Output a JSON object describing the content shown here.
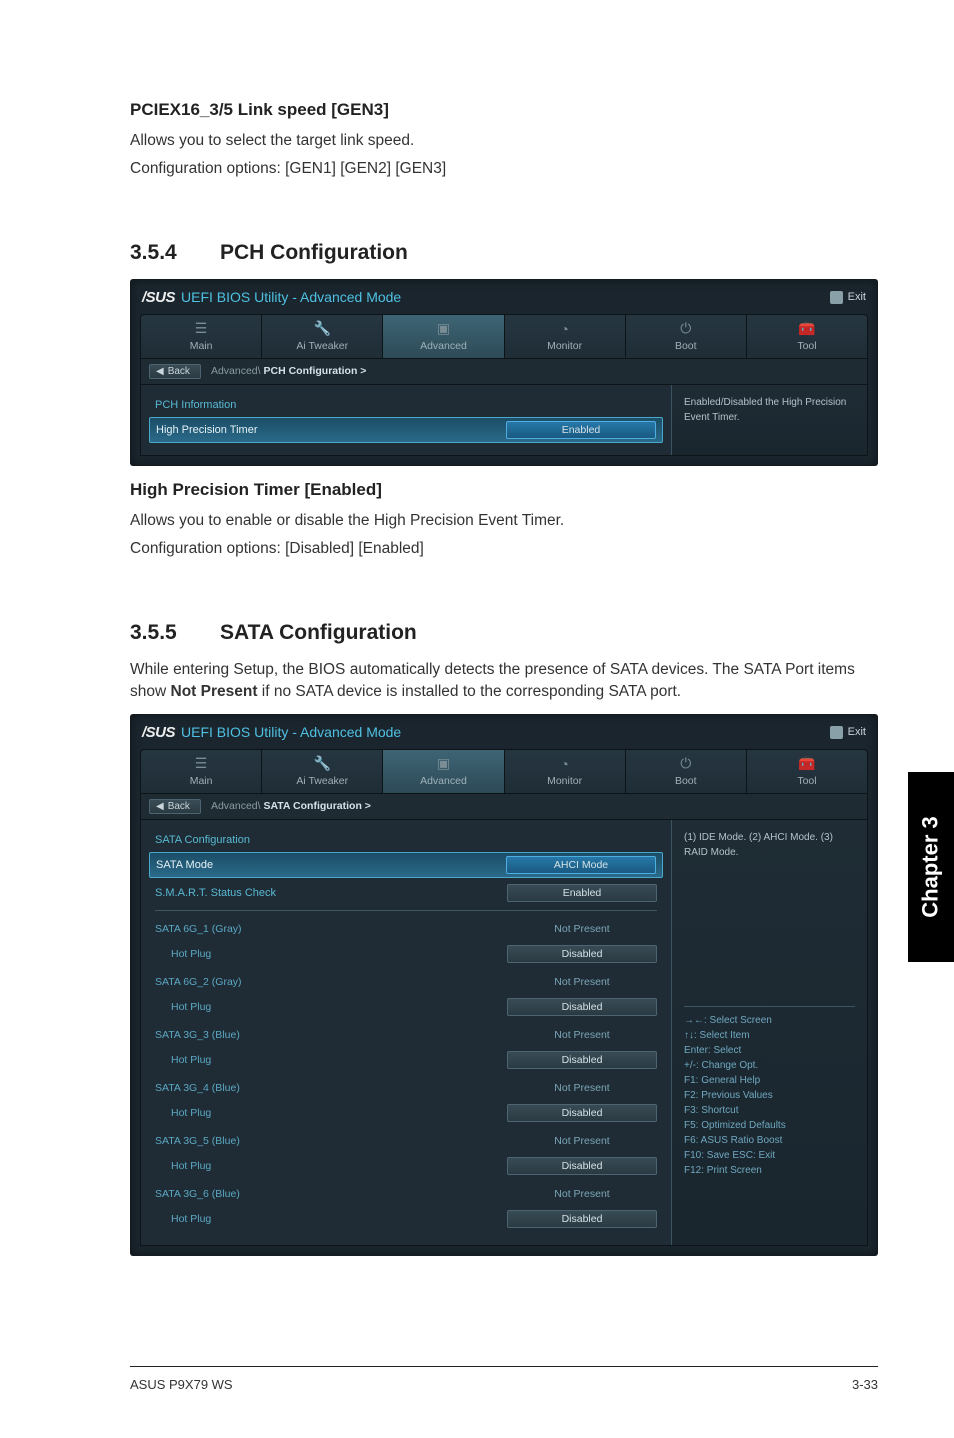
{
  "sec1": {
    "title": "PCIEX16_3/5 Link speed [GEN3]",
    "line1": "Allows you to select the target link speed.",
    "line2": "Configuration options: [GEN1] [GEN2] [GEN3]"
  },
  "sub354": {
    "num": "3.5.4",
    "title": "PCH Configuration"
  },
  "bios_logo": "/SUS",
  "bios_title": "UEFI BIOS Utility - Advanced Mode",
  "exit_label": "Exit",
  "tabs": {
    "main": "Main",
    "ai": "Ai  Tweaker",
    "adv": "Advanced",
    "mon": "Monitor",
    "boot": "Boot",
    "tool": "Tool"
  },
  "back_label": "Back",
  "bc1_path": "Advanced\\",
  "bc1_current": "PCH Configuration  >",
  "pch": {
    "info": "PCH Information",
    "hpt_label": "High Precision Timer",
    "hpt_value": "Enabled",
    "help": "Enabled/Disabled the High Precision Event Timer."
  },
  "sec2": {
    "title": "High Precision Timer [Enabled]",
    "line1": "Allows you to enable or disable the High Precision Event Timer.",
    "line2": "Configuration options: [Disabled] [Enabled]"
  },
  "sub355": {
    "num": "3.5.5",
    "title": "SATA Configuration",
    "desc": "While entering Setup, the BIOS automatically detects the presence of SATA devices. The SATA Port items show Not Present if no SATA device is installed to the corresponding SATA port."
  },
  "bc2_path": "Advanced\\",
  "bc2_current": "SATA Configuration  >",
  "sata": {
    "config": "SATA Configuration",
    "mode_label": "SATA Mode",
    "mode_value": "AHCI Mode",
    "smart_label": "S.M.A.R.T. Status Check",
    "smart_value": "Enabled",
    "help": "(1) IDE Mode. (2) AHCI Mode. (3) RAID Mode.",
    "not_present": "Not Present",
    "disabled": "Disabled",
    "ports": [
      {
        "name": "SATA 6G_1 (Gray)",
        "hot": "Hot Plug"
      },
      {
        "name": "SATA 6G_2 (Gray)",
        "hot": "Hot Plug"
      },
      {
        "name": "SATA 3G_3 (Blue)",
        "hot": "Hot Plug"
      },
      {
        "name": "SATA 3G_4 (Blue)",
        "hot": "Hot Plug"
      },
      {
        "name": "SATA 3G_5 (Blue)",
        "hot": "Hot Plug"
      },
      {
        "name": "SATA 3G_6 (Blue)",
        "hot": "Hot Plug"
      }
    ]
  },
  "keys": {
    "k1": "→←:  Select Screen",
    "k2": "↑↓:  Select Item",
    "k3": "Enter: Select",
    "k4": "+/-:  Change Opt.",
    "k5": "F1:  General Help",
    "k6": "F2:  Previous Values",
    "k7": "F3:  Shortcut",
    "k8": "F5:  Optimized Defaults",
    "k9": "F6:  ASUS Ratio Boost",
    "k10": "F10:  Save   ESC:  Exit",
    "k11": "F12:  Print Screen"
  },
  "chapter": "Chapter 3",
  "footer": {
    "left": "ASUS P9X79 WS",
    "right": "3-33"
  }
}
